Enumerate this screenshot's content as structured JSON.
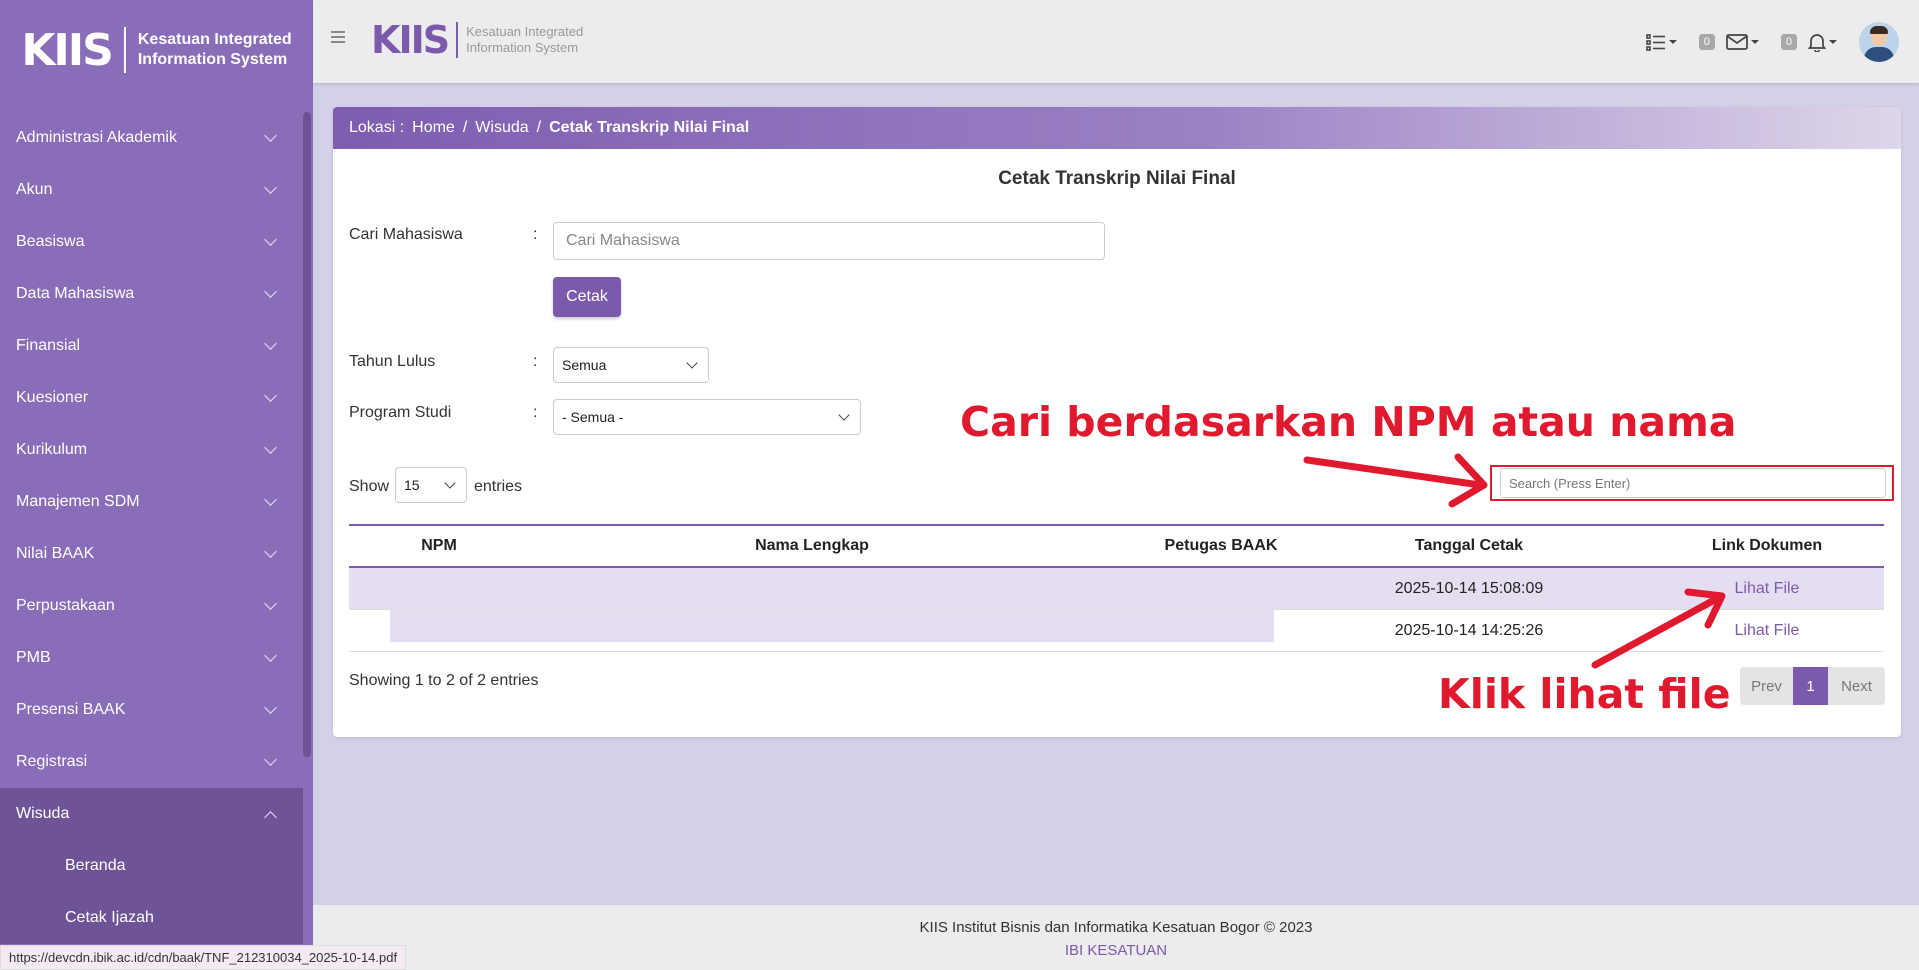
{
  "brand": {
    "mark": "KIIS",
    "line1": "Kesatuan Integrated",
    "line2": "Information System"
  },
  "sidebar": {
    "items": [
      {
        "label": "Administrasi Akademik"
      },
      {
        "label": "Akun"
      },
      {
        "label": "Beasiswa"
      },
      {
        "label": "Data Mahasiswa"
      },
      {
        "label": "Finansial"
      },
      {
        "label": "Kuesioner"
      },
      {
        "label": "Kurikulum"
      },
      {
        "label": "Manajemen SDM"
      },
      {
        "label": "Nilai BAAK"
      },
      {
        "label": "Perpustakaan"
      },
      {
        "label": "PMB"
      },
      {
        "label": "Presensi BAAK"
      },
      {
        "label": "Registrasi"
      },
      {
        "label": "Wisuda"
      }
    ],
    "wisuda_sub": [
      {
        "label": "Beranda"
      },
      {
        "label": "Cetak Ijazah"
      }
    ]
  },
  "topbar": {
    "mail_count": "0",
    "notif_count": "0"
  },
  "breadcrumb": {
    "prefix": "Lokasi :",
    "home": "Home",
    "sep": "/",
    "section": "Wisuda",
    "current": "Cetak Transkrip Nilai Final"
  },
  "page_title": "Cetak Transkrip Nilai Final",
  "form": {
    "cari_label": "Cari Mahasiswa",
    "cari_placeholder": "Cari Mahasiswa",
    "cetak_button": "Cetak",
    "tahun_label": "Tahun Lulus",
    "tahun_value": "Semua",
    "prodi_label": "Program Studi",
    "prodi_value": "- Semua -",
    "colon": ":"
  },
  "table_controls": {
    "show": "Show",
    "length": "15",
    "entries": "entries",
    "search_placeholder": "Search (Press Enter)"
  },
  "table": {
    "headers": {
      "npm": "NPM",
      "nama": "Nama Lengkap",
      "petugas": "Petugas BAAK",
      "tanggal": "Tanggal Cetak",
      "link": "Link Dokumen"
    },
    "rows": [
      {
        "npm": "",
        "nama": "",
        "petugas": "",
        "tanggal": "2025-10-14 15:08:09",
        "link": "Lihat File"
      },
      {
        "npm": "",
        "nama": "",
        "petugas": "",
        "tanggal": "2025-10-14 14:25:26",
        "link": "Lihat File"
      }
    ]
  },
  "info": "Showing 1 to 2 of 2 entries",
  "pager": {
    "prev": "Prev",
    "current": "1",
    "next": "Next"
  },
  "annotations": {
    "search_hint": "Cari berdasarkan NPM atau nama",
    "file_hint": "Klik lihat file",
    "color": "#e0192f"
  },
  "footer": {
    "line1": "KIIS Institut Bisnis dan Informatika Kesatuan Bogor © 2023",
    "line2": "IBI KESATUAN"
  },
  "status_url": "https://devcdn.ibik.ac.id/cdn/baak/TNF_212310034_2025-10-14.pdf",
  "colors": {
    "primary": "#7b5aac",
    "sidebar": "#8a6db8",
    "sidebar_open": "#6f5397",
    "background": "#d4d0e8"
  }
}
